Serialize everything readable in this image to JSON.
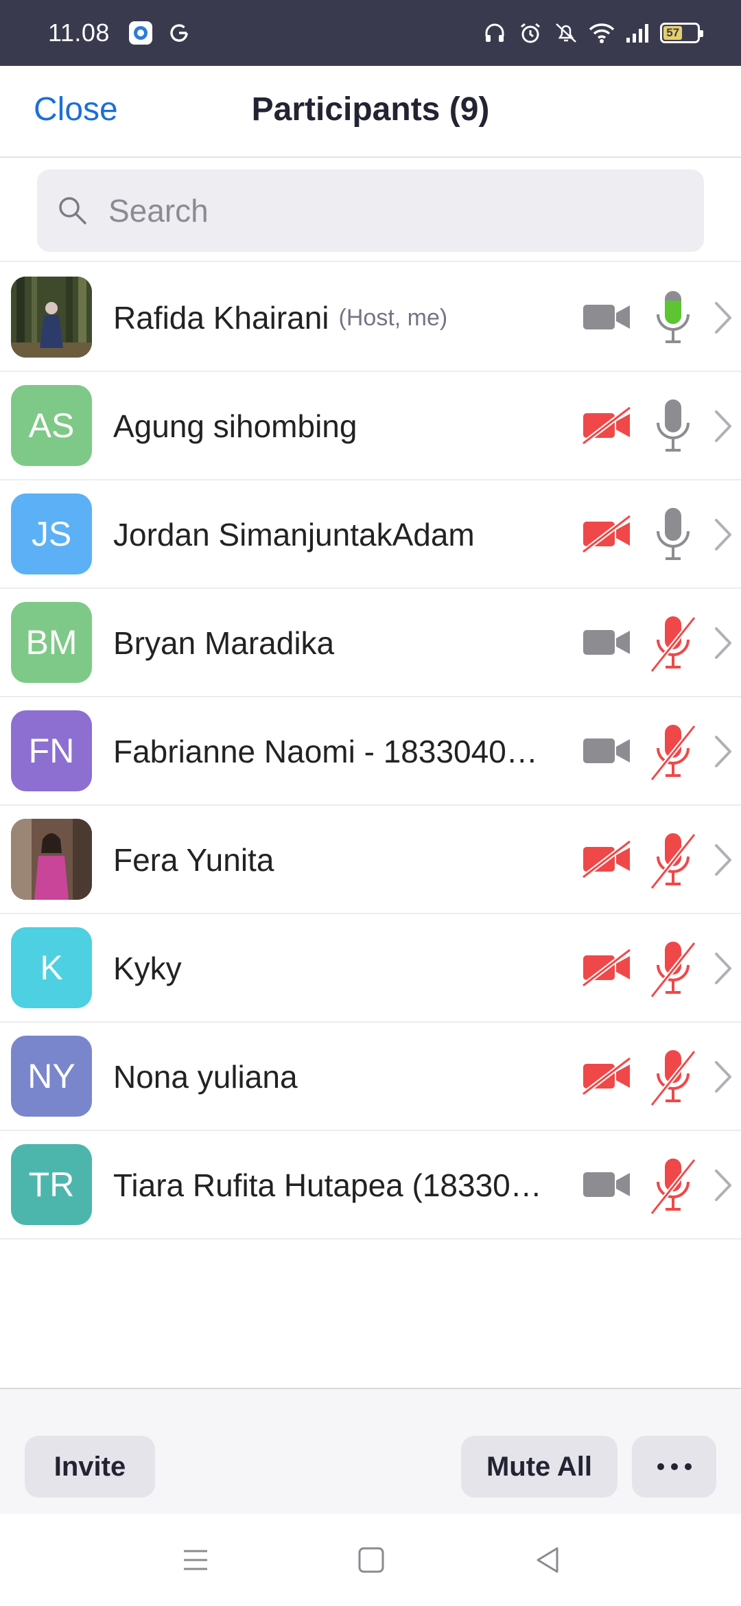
{
  "status_bar": {
    "time": "11.08",
    "battery_level": "57",
    "left_icons": [
      "record-icon",
      "google-icon"
    ],
    "right_icons": [
      "headphones-icon",
      "alarm-icon",
      "vibrate-off-icon",
      "wifi-icon",
      "signal-icon",
      "battery-icon"
    ]
  },
  "header": {
    "close_label": "Close",
    "title": "Participants (9)"
  },
  "search": {
    "placeholder": "Search",
    "value": ""
  },
  "participants": [
    {
      "name": "Rafida Khairani",
      "tag": "(Host, me)",
      "initials": "",
      "avatar_type": "photo",
      "avatar_color": "#4a5a3a",
      "video": "on",
      "audio": "speaking"
    },
    {
      "name": "Agung sihombing",
      "tag": "",
      "initials": "AS",
      "avatar_type": "initials",
      "avatar_color": "#7ec987",
      "video": "off",
      "audio": "on"
    },
    {
      "name": "Jordan SimanjuntakAdam",
      "tag": "",
      "initials": "JS",
      "avatar_type": "initials",
      "avatar_color": "#5cb0f5",
      "video": "off",
      "audio": "on"
    },
    {
      "name": "Bryan Maradika",
      "tag": "",
      "initials": "BM",
      "avatar_type": "initials",
      "avatar_color": "#7ec987",
      "video": "on",
      "audio": "muted"
    },
    {
      "name": "Fabrianne Naomi - 1833040…",
      "tag": "",
      "initials": "FN",
      "avatar_type": "initials",
      "avatar_color": "#8c6fd1",
      "video": "on",
      "audio": "muted"
    },
    {
      "name": "Fera Yunita",
      "tag": "",
      "initials": "",
      "avatar_type": "photo",
      "avatar_color": "#8a6b5a",
      "video": "off",
      "audio": "muted"
    },
    {
      "name": "Kyky",
      "tag": "",
      "initials": "K",
      "avatar_type": "initials",
      "avatar_color": "#4dd0e1",
      "video": "off",
      "audio": "muted"
    },
    {
      "name": "Nona yuliana",
      "tag": "",
      "initials": "NY",
      "avatar_type": "initials",
      "avatar_color": "#7986cb",
      "video": "off",
      "audio": "muted"
    },
    {
      "name": "Tiara Rufita Hutapea (18330…",
      "tag": "",
      "initials": "TR",
      "avatar_type": "initials",
      "avatar_color": "#4db6ac",
      "video": "on",
      "audio": "muted"
    }
  ],
  "footer": {
    "invite_label": "Invite",
    "mute_all_label": "Mute All",
    "more_icon": "more-horizontal-icon"
  },
  "colors": {
    "accent": "#1b6fd8",
    "muted_red": "#f04848",
    "speaking_green": "#5cc531",
    "icon_gray": "#8c8c91"
  }
}
